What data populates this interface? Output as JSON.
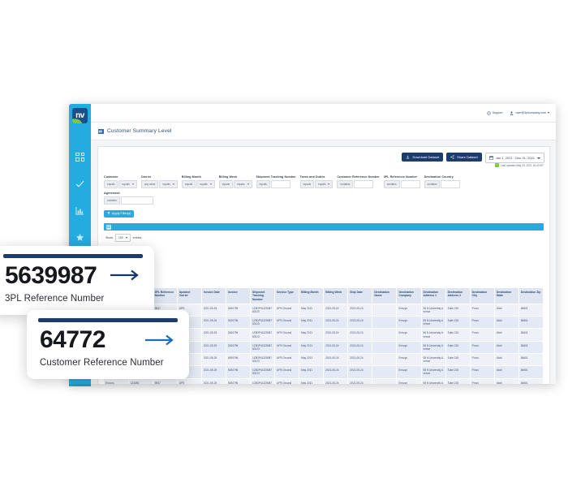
{
  "app": {
    "logo_text": "nv",
    "page_title": "Customer Summary Level",
    "topbar": {
      "support_label": "Support",
      "user_label": "user@3plcompany.com"
    },
    "sidebar": {
      "items": [
        {
          "name": "dashboard",
          "icon": "grid-icon"
        },
        {
          "name": "approvals",
          "icon": "check-icon"
        },
        {
          "name": "reports",
          "icon": "bar-chart-icon"
        },
        {
          "name": "favorites",
          "icon": "star-icon"
        }
      ]
    },
    "actions": {
      "download_label": "Download Dataset",
      "share_label": "Share Dataset",
      "date_range": "Jan 1, 2021 - Dec 31, 2021",
      "last_updated": "Last updated May 29, 2021 16:40 MT",
      "updated_badge": "✓"
    },
    "filters": {
      "row": [
        {
          "label": "Customer",
          "op1": "equals",
          "op2": "equals",
          "has_input": false
        },
        {
          "label": "Carrier",
          "op1": "any value",
          "op2": "equals",
          "has_input": false
        },
        {
          "label": "Billing Month",
          "op1": "equals",
          "op2": "equals",
          "has_input": false
        },
        {
          "label": "Billing Week",
          "op1": "equals",
          "op2": "equals",
          "has_input": false
        },
        {
          "label": "Shipment Tracking Number",
          "op1": "equals",
          "op2": "",
          "has_input": true
        },
        {
          "label": "Taxes and Duties",
          "op1": "equals",
          "op2": "equals",
          "has_input": false
        },
        {
          "label": "Customer Reference Number",
          "op1": "contains",
          "op2": "",
          "has_input": true
        },
        {
          "label": "3PL Reference Number",
          "op1": "contains",
          "op2": "",
          "has_input": true
        },
        {
          "label": "Destination Country",
          "op1": "contains",
          "op2": "",
          "has_input": true
        }
      ],
      "agreement": {
        "label": "Agreement",
        "op1": "contains"
      },
      "apply_label": "Apply Filter(s)"
    },
    "table_controls": {
      "show_label": "Show",
      "page_size": "100",
      "entries_label": "entries"
    },
    "table": {
      "columns": [
        "Customer",
        "Customer Reference Number",
        "3PL Reference Number",
        "Updated Carrier",
        "Invoice Date",
        "Invoice",
        "Shipment Tracking Number",
        "Service Type",
        "Billing Month",
        "Billing Week",
        "Ship Date",
        "Destination Name",
        "Destination Company",
        "Destination Address 1",
        "Destination Address 2",
        "Destination City",
        "Destination State",
        "Destination Zip"
      ],
      "rows": [
        [
          "Envoys",
          "123456",
          "9847",
          "UPS",
          "2021-05-25",
          "0000796",
          "1Z5DP41325087502J3",
          "UPS Ground",
          "May 2021",
          "2021-05-24",
          "2021-05-24",
          "",
          "Envoys",
          "55 N University Avenue",
          "Suite 215",
          "Provo",
          "Utah",
          "84601"
        ],
        [
          "Envoys",
          "123456",
          "9847",
          "UPS",
          "2021-05-25",
          "0000796",
          "1Z5DP41325087502J3",
          "UPS Ground",
          "May 2021",
          "2021-05-24",
          "2021-05-24",
          "",
          "Envoys",
          "55 N University Avenue",
          "Suite 215",
          "Provo",
          "Utah",
          "84601"
        ],
        [
          "Envoys",
          "123456",
          "9847",
          "UPS",
          "2021-05-25",
          "0000796",
          "1Z5DP41325087502J3",
          "UPS Ground",
          "May 2021",
          "2021-05-24",
          "2021-05-24",
          "",
          "Envoys",
          "55 N University Avenue",
          "Suite 215",
          "Provo",
          "Utah",
          "84601"
        ],
        [
          "Envoys",
          "123456",
          "9847",
          "UPS",
          "2021-05-25",
          "0000796",
          "1Z5DP41325087502J3",
          "UPS Ground",
          "May 2021",
          "2021-05-24",
          "2021-05-24",
          "",
          "Envoys",
          "55 N University Avenue",
          "Suite 215",
          "Provo",
          "Utah",
          "84601"
        ],
        [
          "Envoys",
          "123456",
          "9847",
          "UPS",
          "2021-05-25",
          "0000796",
          "1Z5DP41325087502J3",
          "UPS Ground",
          "May 2021",
          "2021-05-24",
          "2021-05-24",
          "",
          "Envoys",
          "55 N University Avenue",
          "Suite 215",
          "Provo",
          "Utah",
          "84601"
        ],
        [
          "Envoys",
          "123456",
          "9847",
          "UPS",
          "2021-05-25",
          "0000796",
          "1Z5DP41325087502J3",
          "UPS Ground",
          "May 2021",
          "2021-05-24",
          "2021-05-24",
          "",
          "Envoys",
          "55 N University Avenue",
          "Suite 215",
          "Provo",
          "Utah",
          "84601"
        ],
        [
          "Envoys",
          "123456",
          "9847",
          "UPS",
          "2021-05-25",
          "0000796",
          "1Z5DP41325087502J3",
          "UPS Ground",
          "May 2021",
          "2021-05-24",
          "2021-05-24",
          "",
          "Envoys",
          "55 N University Avenue",
          "Suite 215",
          "Provo",
          "Utah",
          "84601"
        ]
      ]
    }
  },
  "callouts": [
    {
      "id": "3pl",
      "value": "5639987",
      "label": "3PL Reference Number"
    },
    {
      "id": "cust",
      "value": "64772",
      "label": "Customer Reference Number"
    }
  ],
  "colors": {
    "sidebar_blue": "#22ace0",
    "accent_blue": "#29a9e0",
    "navy": "#1d3c6e",
    "table_header": "#dfe6f2"
  }
}
